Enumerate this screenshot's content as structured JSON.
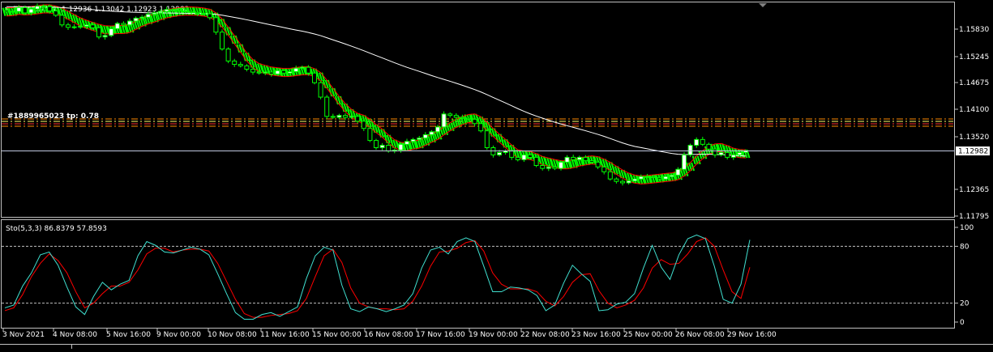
{
  "main_header": {
    "symbol_text": "EURUSD,H4",
    "ohlc_text": "1.12936 1.13042 1.12923 1.12982"
  },
  "sub_header": {
    "indicator_text": "Sto(5,3,3) 86.8379 57.8593"
  },
  "level_label_text": "#1889965023 tp: 0.78",
  "colors": {
    "background": "#000000",
    "bull_candle": "#ffffff",
    "bear_candle": "#000000",
    "candle_wick": "#00ff00",
    "ma_slow": "#ffffff",
    "band_outer": "#ff0000",
    "band_inner": "#00ff00",
    "level_orange": "#ff8c00",
    "level_red": "#ff3030",
    "level_yellow": "#ffff66",
    "stoch_main": "#40e0d0",
    "stoch_signal": "#ff0000",
    "price_line": "#c0c8e0",
    "frame": "#c0c0c0"
  },
  "chart_data": [
    {
      "type": "candlestick",
      "title": "EURUSD,H4",
      "price_axis": {
        "ticks": [
          "1.15830",
          "1.15245",
          "1.14675",
          "1.14100",
          "1.13520",
          "1.12365",
          "1.11795"
        ],
        "range": [
          1.1163,
          1.1605
        ]
      },
      "current_price": {
        "label": "1.12982",
        "value": 1.12982
      },
      "time_axis": [
        "3 Nov 2021",
        "4 Nov 08:00",
        "5 Nov 16:00",
        "9 Nov 00:00",
        "10 Nov 08:00",
        "11 Nov 16:00",
        "15 Nov 00:00",
        "16 Nov 08:00",
        "17 Nov 16:00",
        "19 Nov 00:00",
        "22 Nov 08:00",
        "23 Nov 16:00",
        "25 Nov 00:00",
        "26 Nov 08:00",
        "29 Nov 16:00"
      ],
      "closes": [
        1.1587,
        1.1588,
        1.1596,
        1.1585,
        1.1593,
        1.1599,
        1.1598,
        1.1589,
        1.158,
        1.156,
        1.1555,
        1.1556,
        1.1557,
        1.156,
        1.1554,
        1.1535,
        1.1538,
        1.1552,
        1.1563,
        1.156,
        1.1568,
        1.1574,
        1.1576,
        1.1582,
        1.1585,
        1.1588,
        1.1592,
        1.159,
        1.1589,
        1.1588,
        1.1586,
        1.1584,
        1.1583,
        1.1575,
        1.1545,
        1.151,
        1.1485,
        1.1478,
        1.1475,
        1.1468,
        1.1462,
        1.146,
        1.1462,
        1.1458,
        1.1465,
        1.146,
        1.1463,
        1.147,
        1.1472,
        1.146,
        1.144,
        1.141,
        1.137,
        1.1368,
        1.1372,
        1.1368,
        1.137,
        1.136,
        1.1345,
        1.132,
        1.1305,
        1.131,
        1.1298,
        1.13,
        1.1312,
        1.1318,
        1.1322,
        1.1325,
        1.1332,
        1.1338,
        1.1348,
        1.1375,
        1.1372,
        1.1368,
        1.1366,
        1.1364,
        1.1355,
        1.134,
        1.1305,
        1.129,
        1.1295,
        1.1298,
        1.1285,
        1.128,
        1.129,
        1.1285,
        1.1268,
        1.1262,
        1.1265,
        1.1262,
        1.1275,
        1.1285,
        1.128,
        1.1285,
        1.1278,
        1.1275,
        1.1265,
        1.1255,
        1.124,
        1.1235,
        1.1232,
        1.1236,
        1.124,
        1.1245,
        1.1245,
        1.1243,
        1.124,
        1.1245,
        1.1248,
        1.126,
        1.129,
        1.131,
        1.1322,
        1.1312,
        1.1302,
        1.129,
        1.1295,
        1.1285,
        1.129,
        1.1295,
        1.1298
      ]
    },
    {
      "type": "line",
      "title": "Sto(5,3,3) 86.8379 57.8593",
      "y_ticks": [
        "100",
        "80",
        "20",
        "0"
      ],
      "ylim": [
        0,
        100
      ],
      "levels": [
        80,
        20
      ],
      "main_value": 86.8379,
      "signal_value": 57.8593,
      "main": [
        15,
        18,
        38,
        52,
        71,
        74,
        60,
        37,
        16,
        8,
        27,
        42,
        34,
        40,
        44,
        70,
        85,
        81,
        74,
        73,
        76,
        79,
        77,
        71,
        51,
        30,
        10,
        3,
        3,
        8,
        10,
        6,
        11,
        16,
        46,
        70,
        79,
        76,
        39,
        14,
        11,
        16,
        14,
        11,
        14,
        18,
        30,
        57,
        76,
        79,
        72,
        85,
        89,
        85,
        59,
        32,
        32,
        37,
        36,
        34,
        28,
        12,
        18,
        41,
        60,
        51,
        43,
        12,
        13,
        19,
        21,
        30,
        57,
        81,
        58,
        45,
        71,
        88,
        92,
        88,
        59,
        24,
        20,
        40,
        86.8379
      ],
      "signal": [
        12,
        15,
        29,
        48,
        62,
        72,
        65,
        52,
        32,
        15,
        20,
        30,
        38,
        38,
        42,
        55,
        72,
        78,
        78,
        74,
        76,
        77,
        77,
        75,
        62,
        43,
        24,
        9,
        5,
        5,
        7,
        8,
        9,
        12,
        25,
        48,
        70,
        77,
        63,
        36,
        20,
        16,
        14,
        14,
        13,
        14,
        22,
        38,
        59,
        74,
        75,
        78,
        84,
        86,
        75,
        52,
        40,
        35,
        35,
        35,
        32,
        22,
        17,
        27,
        42,
        50,
        51,
        33,
        20,
        15,
        18,
        23,
        36,
        57,
        66,
        61,
        62,
        72,
        85,
        89,
        80,
        55,
        32,
        25,
        57.8593
      ]
    }
  ]
}
